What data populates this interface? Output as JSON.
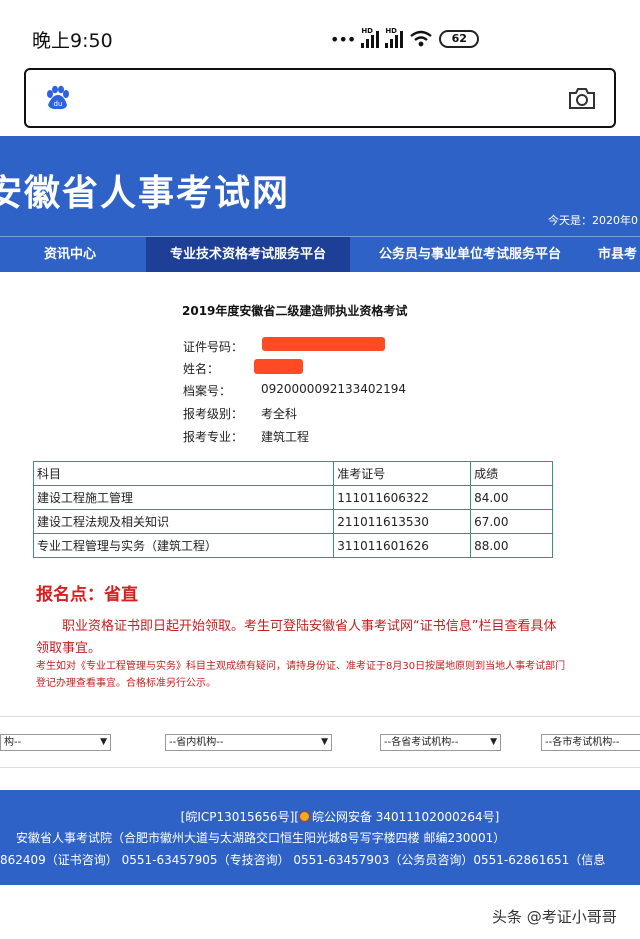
{
  "status_bar": {
    "time": "晚上9:50",
    "signal_hd_1": "HD",
    "signal_hd_2": "HD",
    "battery": "62"
  },
  "browser": {
    "search_icon": "baidu-paw-icon",
    "camera_icon": "camera-icon"
  },
  "site": {
    "title": "安徽省人事考试网",
    "date_text": "今天是：2020年0"
  },
  "nav": {
    "items": [
      {
        "label": "资讯中心"
      },
      {
        "label": "专业技术资格考试服务平台"
      },
      {
        "label": "公务员与事业单位考试服务平台"
      },
      {
        "label": "市县考"
      }
    ]
  },
  "result": {
    "exam_title": "2019年度安徽省二级建造师执业资格考试",
    "id_label": "证件号码：",
    "name_label": "姓名：",
    "archive_label": "档案号：",
    "archive_value": "092000009213340219​4",
    "level_label": "报考级别：",
    "level_value": "考全科",
    "major_label": "报考专业：",
    "major_value": "建筑工程"
  },
  "table": {
    "headers": [
      "科目",
      "准考证号",
      "成绩"
    ],
    "rows": [
      [
        "建设工程施工管理",
        "111011606322",
        "84.00"
      ],
      [
        "建设工程法规及相关知识",
        "211011613530",
        "67.00"
      ],
      [
        "专业工程管理与实务（建筑工程）",
        "311011601626",
        "88.00"
      ]
    ]
  },
  "notice": {
    "sign_place": "报名点：省直",
    "main": "职业资格证书即日起开始领取。考生可登陆安徽省人事考试网“证书信息”栏目查看具体领取事宜。",
    "sub": "考生如对《专业工程管理与实务》科目主观成绩有疑问，请持身份证、准考证于8月30日按属地原则到当地人事考试部门登记办理查看事宜。合格标准另行公示。"
  },
  "selects": {
    "s1": "构--",
    "s2": "--省内机构--",
    "s3": "--各省考试机构--",
    "s4": "--各市考试机构--"
  },
  "footer": {
    "icp": "[皖ICP13015656号][",
    "police": "皖公网安备 34011102000264号]",
    "address": "安徽省人事考试院（合肥市徽州大道与太湖路交口恒生阳光城8号写字楼四楼 邮编230001）",
    "phones": "862409（证书咨询） 0551-63457905（专技咨询） 0551-63457903（公务员咨询）0551-62861651（信息"
  },
  "watermark": "头条 @考证小哥哥"
}
